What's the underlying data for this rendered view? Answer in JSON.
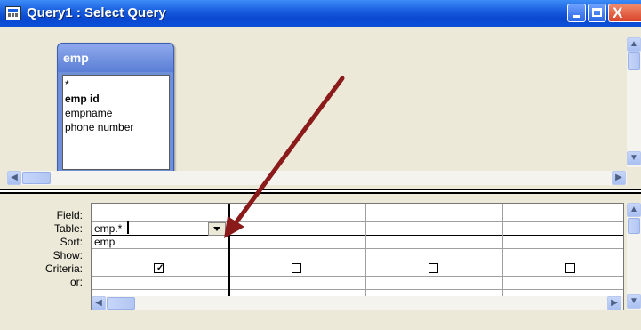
{
  "window": {
    "title": "Query1 : Select Query",
    "controls": {
      "minimize_icon": "minimize-icon",
      "maximize_icon": "maximize-icon",
      "close_glyph": "X"
    }
  },
  "table_box": {
    "name": "emp",
    "fields": [
      "*",
      "emp id",
      "empname",
      "phone number"
    ]
  },
  "grid": {
    "row_labels": [
      "Field:",
      "Table:",
      "Sort:",
      "Show:",
      "Criteria:",
      "or:"
    ],
    "columns": [
      {
        "field": "emp.*",
        "table": "emp",
        "sort": "",
        "show": true,
        "criteria": "",
        "or": ""
      },
      {
        "field": "",
        "table": "",
        "sort": "",
        "show": false,
        "criteria": "",
        "or": ""
      },
      {
        "field": "",
        "table": "",
        "sort": "",
        "show": false,
        "criteria": "",
        "or": ""
      },
      {
        "field": "",
        "table": "",
        "sort": "",
        "show": false,
        "criteria": "",
        "or": ""
      }
    ],
    "check_glyph": "✓"
  },
  "annotation": {
    "arrow_color": "#8b1a1a"
  },
  "colors": {
    "titlebar": "#0a48d0",
    "table_box": "#6f8fd8",
    "background": "#ece9d8"
  }
}
